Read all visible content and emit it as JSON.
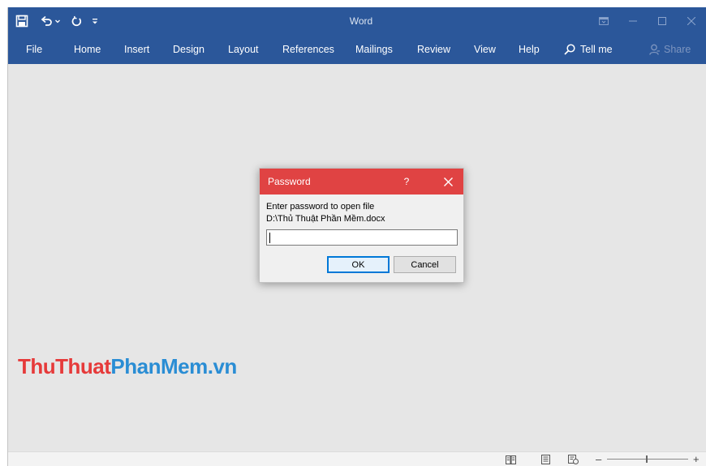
{
  "window": {
    "title": "Word"
  },
  "ribbon": {
    "tabs": [
      {
        "id": "file",
        "label": "File"
      },
      {
        "id": "home",
        "label": "Home"
      },
      {
        "id": "insert",
        "label": "Insert"
      },
      {
        "id": "design",
        "label": "Design"
      },
      {
        "id": "layout",
        "label": "Layout"
      },
      {
        "id": "references",
        "label": "References"
      },
      {
        "id": "mailings",
        "label": "Mailings"
      },
      {
        "id": "review",
        "label": "Review"
      },
      {
        "id": "view",
        "label": "View"
      },
      {
        "id": "help",
        "label": "Help"
      }
    ],
    "tell_me": "Tell me",
    "share": "Share"
  },
  "dialog": {
    "title": "Password",
    "help": "?",
    "prompt": "Enter password to open file",
    "file_path": "D:\\Thủ Thuật Phần Mềm.docx",
    "password_value": "",
    "ok_label": "OK",
    "cancel_label": "Cancel"
  },
  "watermark": {
    "part1": "ThuThuat",
    "part2": "PhanMem.vn"
  },
  "statusbar": {
    "zoom_minus": "–",
    "zoom_plus": "+"
  },
  "colors": {
    "ribbon": "#2b579a",
    "dialog_title": "#e04343",
    "workspace": "#e6e6e6",
    "watermark_red": "#e63a3a",
    "watermark_blue": "#2a8dd4"
  },
  "icons": [
    "save-icon",
    "undo-icon",
    "undo-dropdown-icon",
    "redo-icon",
    "customize-toolbar-icon",
    "ribbon-display-options-icon",
    "minimize-icon",
    "maximize-icon",
    "close-icon",
    "search-icon",
    "share-person-icon",
    "dialog-close-icon",
    "read-mode-icon",
    "print-layout-icon",
    "web-layout-icon"
  ]
}
